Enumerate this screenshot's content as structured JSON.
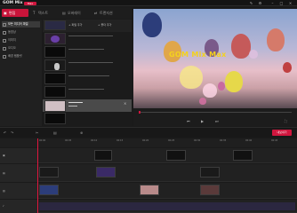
{
  "app": {
    "logo": "GOM Mix",
    "badge": "Max"
  },
  "tabs": [
    {
      "label": "편집",
      "icon": "edit-icon"
    },
    {
      "label": "텍스트",
      "icon": "text-icon"
    },
    {
      "label": "오버레이",
      "icon": "overlay-icon"
    },
    {
      "label": "트랜지션",
      "icon": "transition-icon"
    }
  ],
  "left_panel": {
    "items": [
      "모든 미디어 파일",
      "동영상",
      "이미지",
      "오디오",
      "배경 템플릿"
    ]
  },
  "media_list": {
    "toolbar": [
      "파일 추가",
      "폴더 추가"
    ],
    "selected_index": 5
  },
  "preview": {
    "watermark": "GOM Mix Max"
  },
  "timeline": {
    "export_label": "내보내기",
    "ruler_labels": [
      "00:00",
      "00:05",
      "00:10",
      "00:15",
      "00:20",
      "00:25",
      "00:30",
      "00:35",
      "00:40",
      "00:45"
    ]
  },
  "colors": {
    "accent": "#d0163e",
    "panel": "#1b1b1b",
    "watermark": "#f4d21c"
  }
}
